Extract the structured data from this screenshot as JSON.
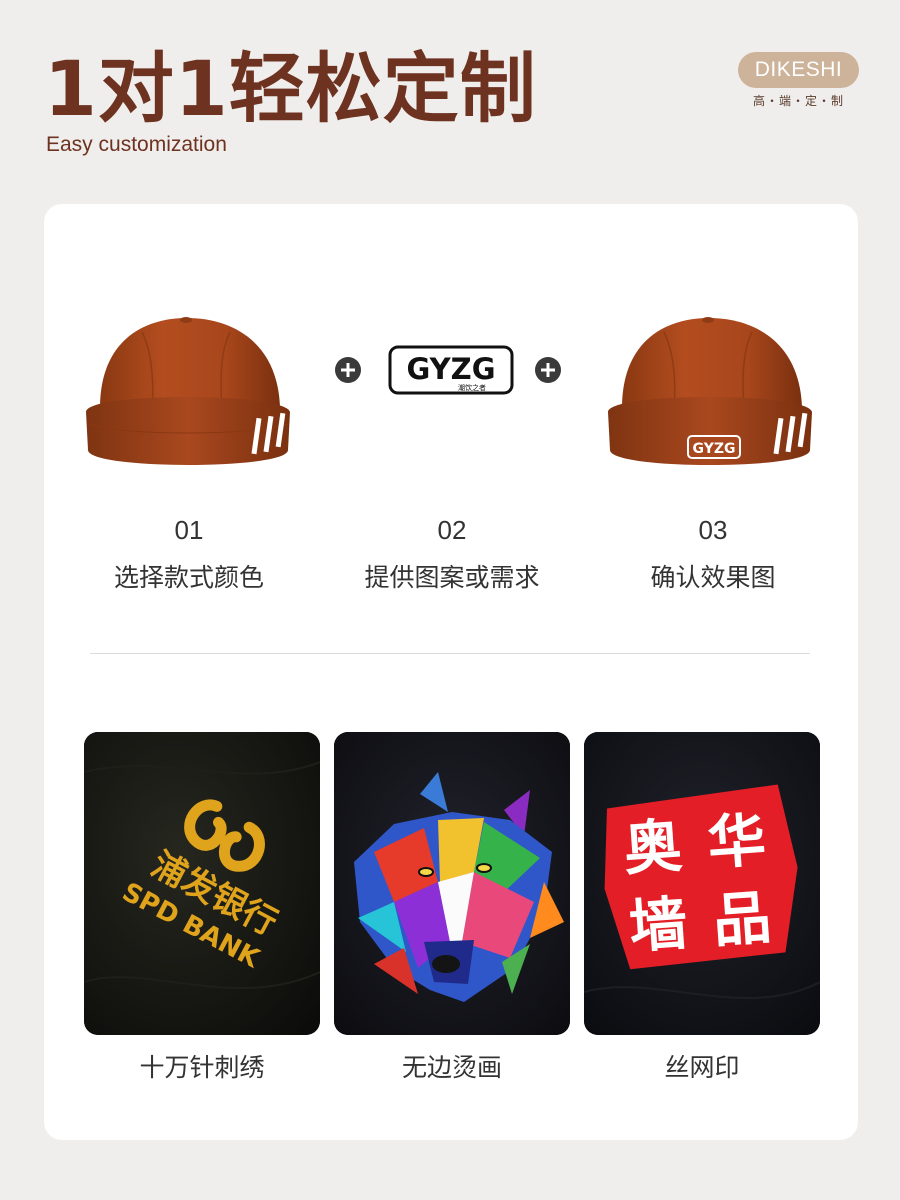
{
  "header": {
    "title": "1对1轻松定制",
    "subtitle": "Easy customization"
  },
  "brand": {
    "name": "DIKESHI",
    "tagline": "高・端・定・制"
  },
  "steps": [
    {
      "num": "01",
      "label": "选择款式颜色",
      "image": "plain-cap"
    },
    {
      "num": "02",
      "label": "提供图案或需求",
      "image": "logo"
    },
    {
      "num": "03",
      "label": "确认效果图",
      "image": "logo-cap"
    }
  ],
  "logo": {
    "text": "GYZG",
    "small": "潮饮之者"
  },
  "crafts": [
    {
      "label": "十万针刺绣",
      "sample_text_cn": "浦发银行",
      "sample_text_en": "SPD BANK"
    },
    {
      "label": "无边烫画",
      "sample": "wolf-artwork"
    },
    {
      "label": "丝网印",
      "sample_text": [
        "奥",
        "华",
        "墙",
        "品"
      ]
    }
  ],
  "colors": {
    "accent": "#6e3220",
    "cap": "#a9481f",
    "badge": "#ccb39a",
    "embroidery": "#e0a31c",
    "print_red": "#e41e26"
  }
}
